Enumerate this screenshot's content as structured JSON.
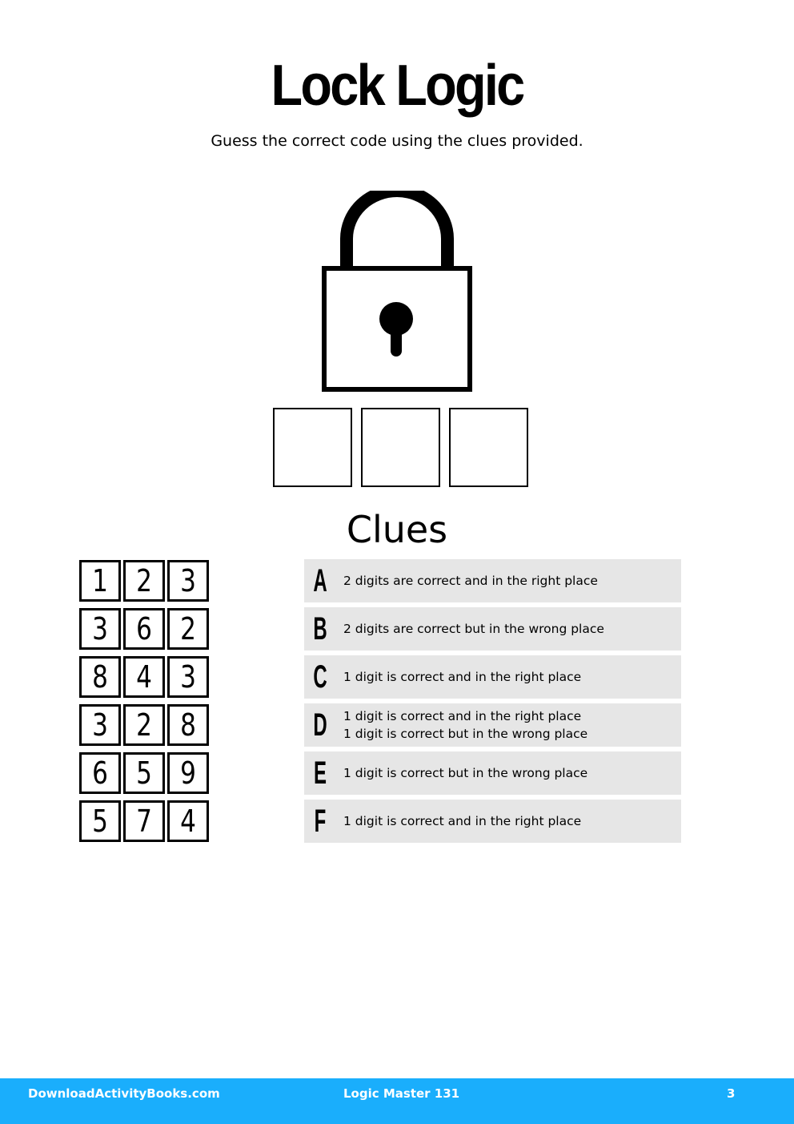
{
  "header": {
    "title": "Lock Logic",
    "subtitle": "Guess the correct code using the clues provided."
  },
  "lock_icon": "padlock-icon",
  "answer_boxes": [
    "",
    "",
    ""
  ],
  "clues_heading": "Clues",
  "guesses": [
    {
      "letter": "A",
      "digits": [
        "1",
        "2",
        "3"
      ],
      "clue": [
        "2 digits are correct and in the right place"
      ]
    },
    {
      "letter": "B",
      "digits": [
        "3",
        "6",
        "2"
      ],
      "clue": [
        "2 digits are correct but in the wrong place"
      ]
    },
    {
      "letter": "C",
      "digits": [
        "8",
        "4",
        "3"
      ],
      "clue": [
        "1 digit is correct and in the right place"
      ]
    },
    {
      "letter": "D",
      "digits": [
        "3",
        "2",
        "8"
      ],
      "clue": [
        "1 digit is correct and in the right place",
        "1 digit is correct but in the wrong place"
      ]
    },
    {
      "letter": "E",
      "digits": [
        "6",
        "5",
        "9"
      ],
      "clue": [
        "1 digit is correct but in the wrong place"
      ]
    },
    {
      "letter": "F",
      "digits": [
        "5",
        "7",
        "4"
      ],
      "clue": [
        "1 digit is correct and in the right place"
      ]
    }
  ],
  "footer": {
    "site": "DownloadActivityBooks.com",
    "book": "Logic Master 131",
    "page": "3",
    "color": "#1aaefc"
  }
}
